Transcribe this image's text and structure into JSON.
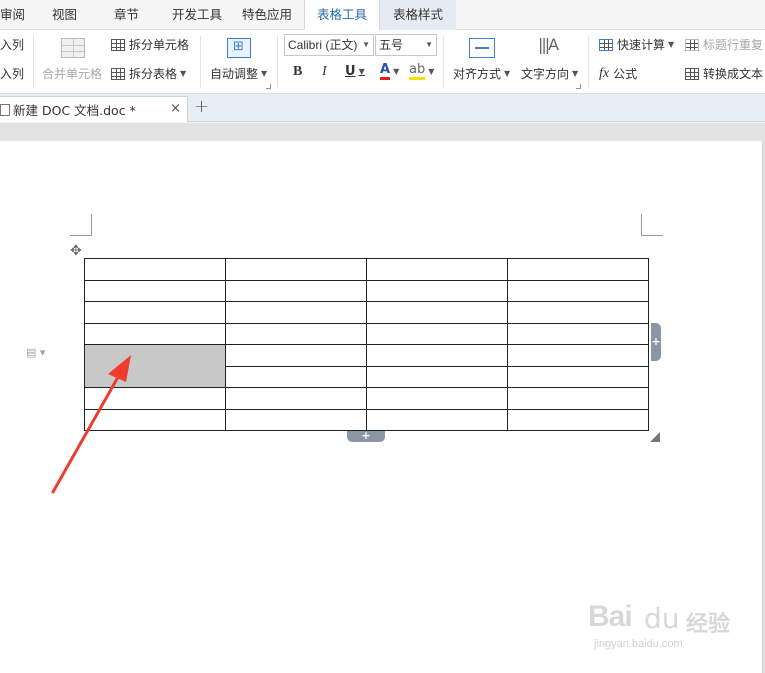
{
  "menu": {
    "items": [
      "审阅",
      "视图",
      "章节",
      "开发工具",
      "特色应用",
      "表格工具",
      "表格样式"
    ],
    "active_index": 5
  },
  "ribbon": {
    "insert_col_left": "入列",
    "insert_col_right": "入列",
    "merge_cells": "合并单元格",
    "split_cells": "拆分单元格",
    "split_table": "拆分表格",
    "auto_adjust": "自动调整",
    "font_name": "Calibri (正文)",
    "font_size": "五号",
    "bold": "B",
    "italic": "I",
    "underline": "U",
    "font_color": "A",
    "align": "对齐方式",
    "text_direction": "文字方向",
    "quick_calc": "快速计算",
    "repeat_header": "标题行重复",
    "formula": "公式",
    "formula_fx": "fx",
    "convert_to_text": "转换成文本"
  },
  "tabs": {
    "document": "新建 DOC 文档.doc *",
    "close": "×",
    "add": "+"
  },
  "document": {
    "table_rows": 8,
    "table_cols": 4,
    "merged_cell_label": ""
  },
  "watermark": {
    "brand": "Bai",
    "brand_cn": "经验",
    "url": "jingyan.baidu.com"
  },
  "colors": {
    "accent": "#2b6cb0",
    "selected_cell": "#c8c8c8",
    "arrow": "#f03c2e",
    "handle": "#8a96a3"
  }
}
